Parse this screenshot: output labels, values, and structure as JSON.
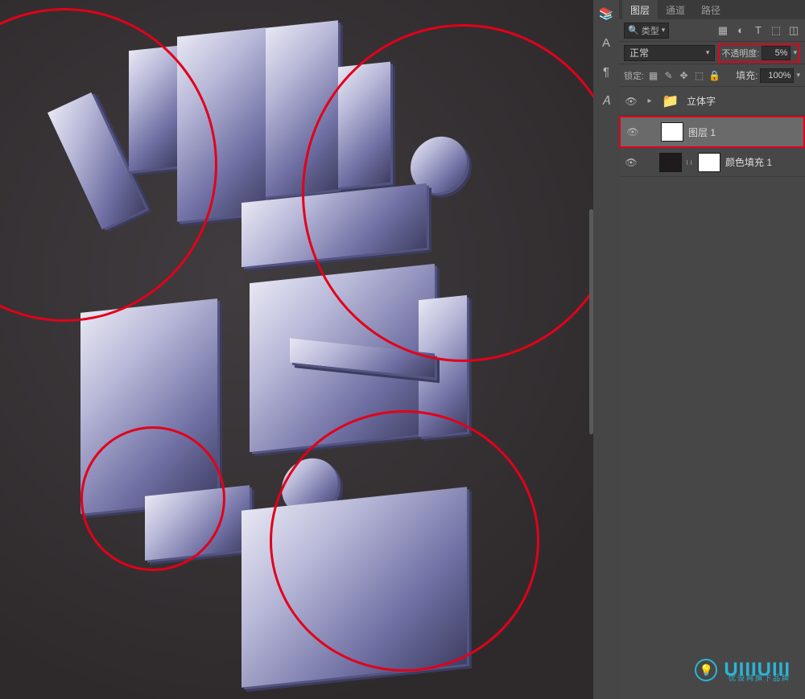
{
  "tabs": {
    "layers": "图层",
    "channels": "通道",
    "paths": "路径"
  },
  "filter": {
    "label": "类型"
  },
  "blend": {
    "mode": "正常"
  },
  "opacity": {
    "label": "不透明度:",
    "value": "5%"
  },
  "lock": {
    "label": "锁定:"
  },
  "fill": {
    "label": "填充:",
    "value": "100%"
  },
  "layers_list": {
    "group": "立体字",
    "layer1": "图层 1",
    "colorFill": "颜色填充 1"
  },
  "watermark": {
    "text": "UIIIUIII",
    "sub": "优设网旗下品牌",
    "bulb": "💡"
  },
  "icons": {
    "search": "🔍",
    "image": "▦",
    "adjust": "◐",
    "type": "T",
    "shape": "⬚",
    "smart": "◫",
    "brush": "✎",
    "fx": "fx",
    "lock": "🔒",
    "eye": "👁",
    "folder": "📁",
    "rail_lib": "📚",
    "rail_A": "A",
    "rail_para": "¶",
    "rail_style": "𝐴"
  }
}
